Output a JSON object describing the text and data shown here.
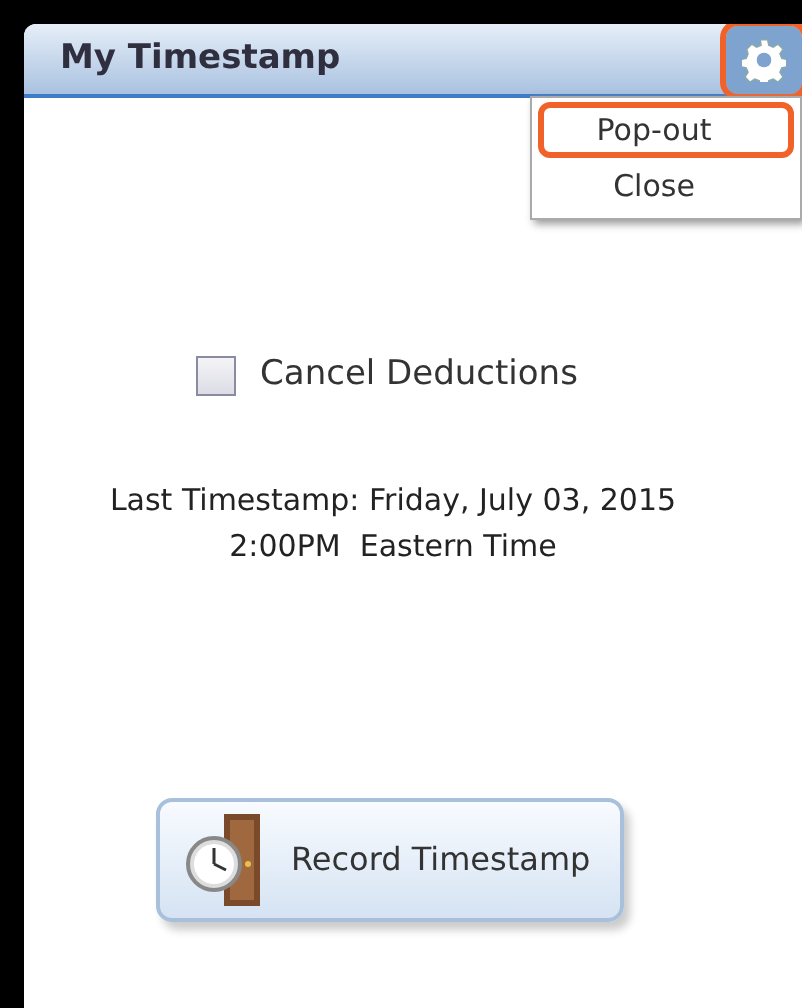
{
  "panel": {
    "title": "My Timestamp",
    "settings_highlighted": true
  },
  "menu": [
    {
      "label": "Pop-out",
      "highlighted": true
    },
    {
      "label": "Close",
      "highlighted": false
    }
  ],
  "checkbox": {
    "label": "Cancel Deductions",
    "checked": false
  },
  "last_timestamp": [
    "Last Timestamp: Friday, July 03, 2015",
    "2:00PM  Eastern Time"
  ],
  "button": {
    "label": "Record Timestamp"
  }
}
